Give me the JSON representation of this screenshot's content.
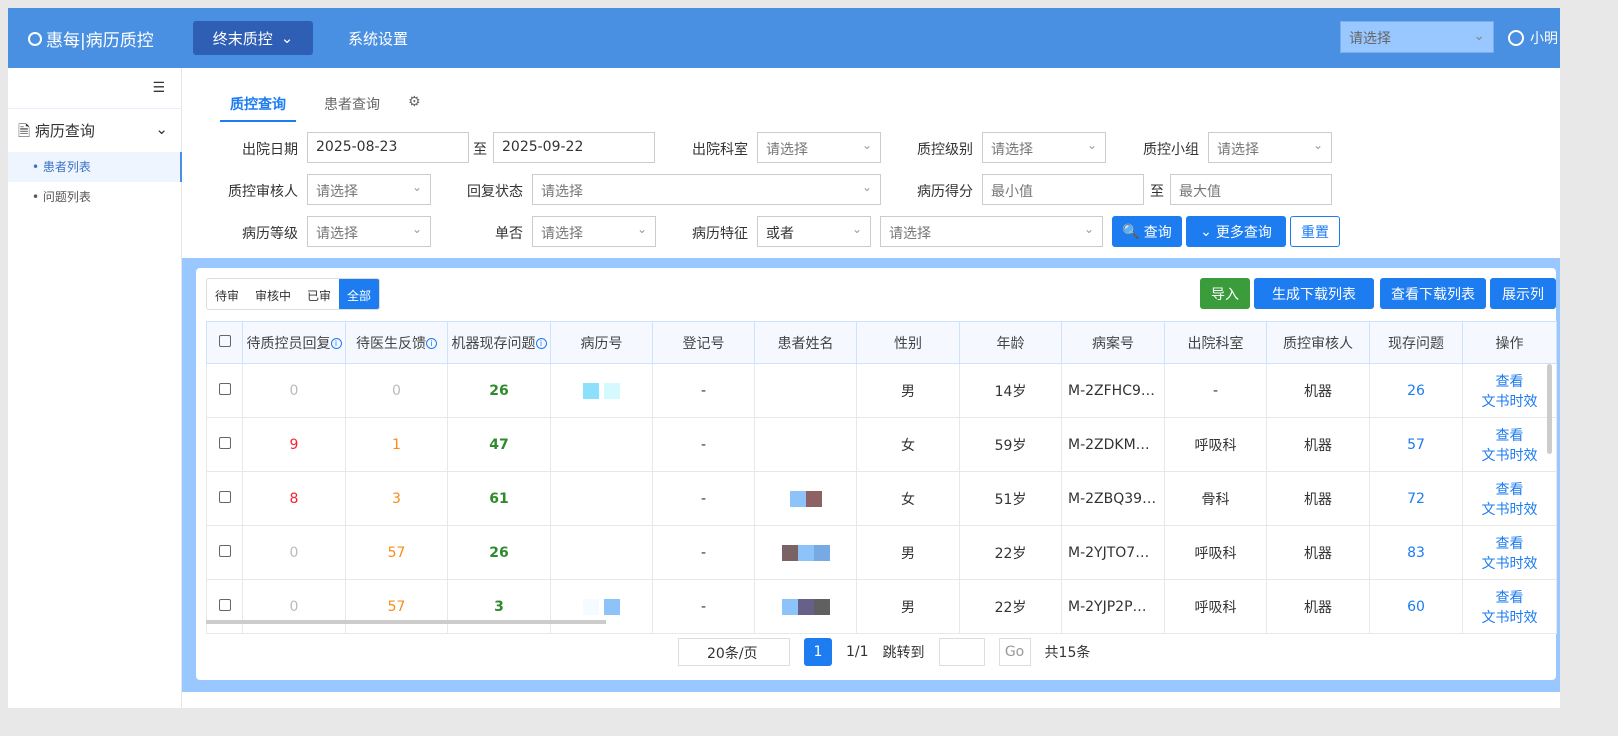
{
  "header": {
    "logo": "惠每|病历质控",
    "nav": [
      {
        "label": "终末质控"
      },
      {
        "label": "系统设置"
      }
    ],
    "select_placeholder": "请选择",
    "user": "小明"
  },
  "sidebar": {
    "group": "病历查询",
    "items": [
      {
        "label": "• 患者列表"
      },
      {
        "label": "• 问题列表"
      }
    ]
  },
  "tabs": [
    {
      "label": "质控查询"
    },
    {
      "label": "患者查询"
    }
  ],
  "filters": {
    "discharge_date": {
      "label": "出院日期",
      "from": "2025-08-23",
      "sep": "至",
      "to": "2025-09-22"
    },
    "dept": {
      "label": "出院科室",
      "value": "请选择"
    },
    "level": {
      "label": "质控级别",
      "value": "请选择"
    },
    "group": {
      "label": "质控小组",
      "value": "请选择"
    },
    "reviewer": {
      "label": "质控审核人",
      "value": "请选择"
    },
    "reply": {
      "label": "回复状态",
      "value": "请选择"
    },
    "score": {
      "label": "病历得分",
      "min": "最小值",
      "sep": "至",
      "max": "最大值"
    },
    "grade": {
      "label": "病历等级",
      "value": "请选择"
    },
    "single": {
      "label": "单否",
      "value": "请选择"
    },
    "feature": {
      "label": "病历特征",
      "op": "或者",
      "value": "请选择"
    },
    "search": "查询",
    "more": "更多查询",
    "reset": "重置"
  },
  "status_tabs": [
    "待审",
    "审核中",
    "已审",
    "全部"
  ],
  "toolbar": {
    "import": "导入",
    "gen": "生成下载列表",
    "view": "查看下载列表",
    "cols": "展示列"
  },
  "table": {
    "headers": [
      "待质控员回复",
      "待医生反馈",
      "机器现存问题",
      "病历号",
      "登记号",
      "患者姓名",
      "性别",
      "年龄",
      "病案号",
      "出院科室",
      "质控审核人",
      "现存问题",
      "操作"
    ],
    "rows": [
      {
        "a": "0",
        "b": "0",
        "c": "26",
        "reg": "-",
        "sex": "男",
        "age": "14岁",
        "case": "M-2ZFHC9…",
        "dept": "-",
        "rev": "机器",
        "cur": "26"
      },
      {
        "a": "9",
        "b": "1",
        "c": "47",
        "reg": "-",
        "sex": "女",
        "age": "59岁",
        "case": "M-2ZDKM…",
        "dept": "呼吸科",
        "rev": "机器",
        "cur": "57"
      },
      {
        "a": "8",
        "b": "3",
        "c": "61",
        "reg": "-",
        "sex": "女",
        "age": "51岁",
        "case": "M-2ZBQ39…",
        "dept": "骨科",
        "rev": "机器",
        "cur": "72"
      },
      {
        "a": "0",
        "b": "57",
        "c": "26",
        "reg": "-",
        "sex": "男",
        "age": "22岁",
        "case": "M-2YJTO7…",
        "dept": "呼吸科",
        "rev": "机器",
        "cur": "83"
      },
      {
        "a": "0",
        "b": "57",
        "c": "3",
        "reg": "-",
        "sex": "男",
        "age": "22岁",
        "case": "M-2YJP2P…",
        "dept": "呼吸科",
        "rev": "机器",
        "cur": "60"
      }
    ],
    "action1": "查看",
    "action2": "文书时效"
  },
  "pager": {
    "size": "20条/页",
    "page": "1",
    "pages": "1/1",
    "jump": "跳转到",
    "go": "Go",
    "total": "共15条"
  }
}
